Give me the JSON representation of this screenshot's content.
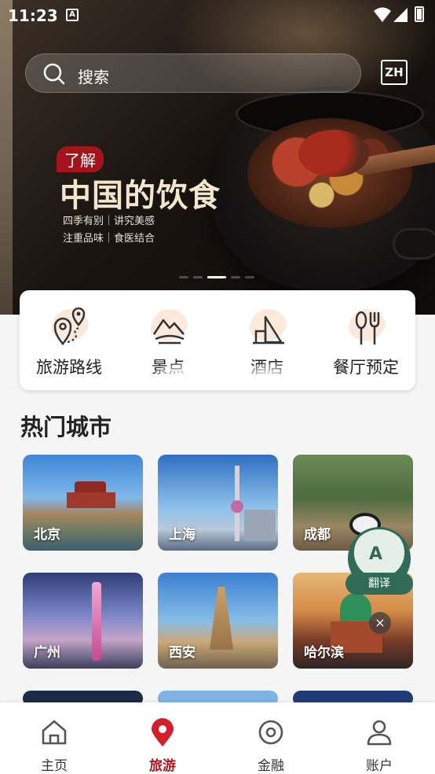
{
  "status_bar": {
    "time": "11:23",
    "notification_icon": "A"
  },
  "search": {
    "placeholder": "搜索",
    "language_button": "ZH"
  },
  "banner": {
    "tag": "了解",
    "headline": "中国的饮食",
    "subline_1": "四季有别｜讲究美感",
    "subline_2": "注重品味｜食医结合",
    "carousel_active_index": 2,
    "carousel_count": 5
  },
  "quick_menu": [
    {
      "label": "旅游路线",
      "icon": "route-pin-icon"
    },
    {
      "label": "景点",
      "icon": "mountain-icon"
    },
    {
      "label": "酒店",
      "icon": "hotel-icon"
    },
    {
      "label": "餐厅预定",
      "icon": "fork-spoon-icon"
    }
  ],
  "hot_cities": {
    "title": "热门城市",
    "cities": [
      {
        "name": "北京"
      },
      {
        "name": "上海"
      },
      {
        "name": "成都"
      },
      {
        "name": "广州"
      },
      {
        "name": "西安"
      },
      {
        "name": "哈尔滨"
      }
    ]
  },
  "translate_widget": {
    "letter": "A",
    "label": "翻译",
    "close": "×"
  },
  "bottom_nav": [
    {
      "label": "主页",
      "icon": "home-icon",
      "active": false
    },
    {
      "label": "旅游",
      "icon": "location-pin-icon",
      "active": true
    },
    {
      "label": "金融",
      "icon": "coin-icon",
      "active": false
    },
    {
      "label": "账户",
      "icon": "user-icon",
      "active": false
    }
  ],
  "colors": {
    "accent": "#b3131e",
    "translate_green": "#2f6b57",
    "headline_gold": "#f2e6cc"
  }
}
